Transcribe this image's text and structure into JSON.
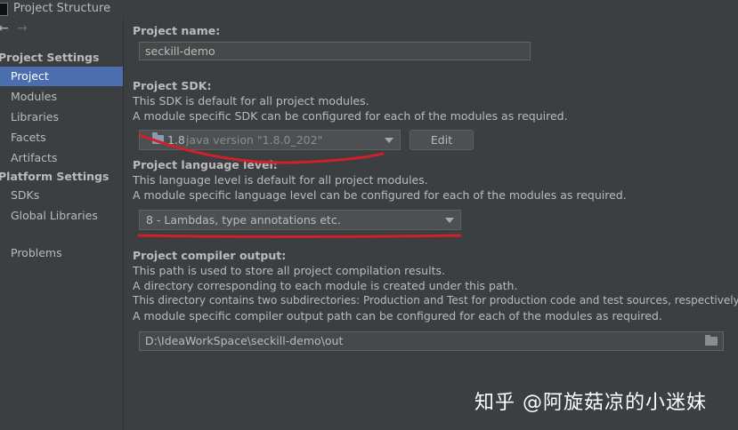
{
  "window": {
    "title": "Project Structure"
  },
  "nav": {
    "back": "←",
    "forward": "→"
  },
  "sidebar": {
    "project_settings_header": "Project Settings",
    "project_settings_items": [
      {
        "label": "Project",
        "selected": true
      },
      {
        "label": "Modules"
      },
      {
        "label": "Libraries"
      },
      {
        "label": "Facets"
      },
      {
        "label": "Artifacts"
      }
    ],
    "platform_settings_header": "Platform Settings",
    "platform_settings_items": [
      {
        "label": "SDKs"
      },
      {
        "label": "Global Libraries"
      }
    ],
    "problems_label": "Problems"
  },
  "main": {
    "project_name": {
      "label": "Project name:",
      "value": "seckill-demo"
    },
    "project_sdk": {
      "label": "Project SDK:",
      "desc1": "This SDK is default for all project modules.",
      "desc2": "A module specific SDK can be configured for each of the modules as required.",
      "sdk_name": "1.8",
      "sdk_version": "java version \"1.8.0_202\"",
      "edit_label": "Edit"
    },
    "language_level": {
      "label": "Project language level:",
      "desc1": "This language level is default for all project modules.",
      "desc2": "A module specific language level can be configured for each of the modules as required.",
      "selected": "8 - Lambdas, type annotations etc."
    },
    "compiler_output": {
      "label": "Project compiler output:",
      "desc1": "This path is used to store all project compilation results.",
      "desc2": "A directory corresponding to each module is created under this path.",
      "desc3": "This directory contains two subdirectories: Production and Test for production code and test sources, respectively.",
      "desc4": "A module specific compiler output path can be configured for each of the modules as required.",
      "path": "D:\\IdeaWorkSpace\\seckill-demo\\out"
    }
  },
  "watermark": "知乎 @阿旋菇凉的小迷妹",
  "colors": {
    "background": "#3c3f41",
    "selection": "#4b6eaf",
    "annotation_red": "#d0202a"
  }
}
